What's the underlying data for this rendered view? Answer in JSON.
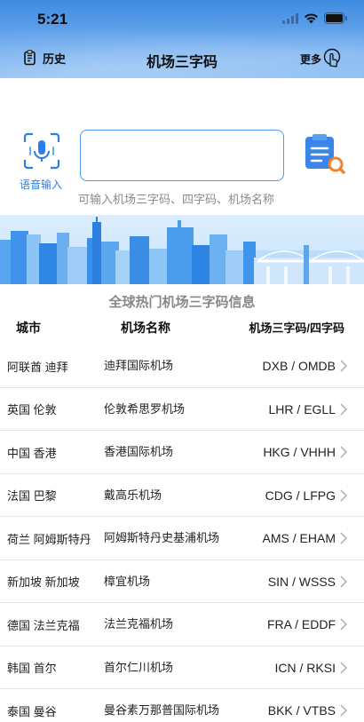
{
  "status": {
    "time": "5:21"
  },
  "nav": {
    "history_label": "历史",
    "title": "机场三字码",
    "more_label": "更多"
  },
  "search": {
    "voice_label": "语音输入",
    "input_value": "",
    "hint": "可输入机场三字码、四字码、机场名称"
  },
  "table": {
    "section_title": "全球热门机场三字码信息",
    "headers": {
      "city": "城市",
      "name": "机场名称",
      "code": "机场三字码/四字码"
    },
    "rows": [
      {
        "city": "阿联酋 迪拜",
        "name": "迪拜国际机场",
        "code": "DXB / OMDB"
      },
      {
        "city": "英国 伦敦",
        "name": "伦敦希思罗机场",
        "code": "LHR / EGLL"
      },
      {
        "city": "中国 香港",
        "name": "香港国际机场",
        "code": "HKG / VHHH"
      },
      {
        "city": "法国 巴黎",
        "name": "戴高乐机场",
        "code": "CDG / LFPG"
      },
      {
        "city": "荷兰 阿姆斯特丹",
        "name": "阿姆斯特丹史基浦机场",
        "code": "AMS / EHAM"
      },
      {
        "city": "新加坡 新加坡",
        "name": "樟宜机场",
        "code": "SIN / WSSS"
      },
      {
        "city": "德国 法兰克福",
        "name": "法兰克福机场",
        "code": "FRA / EDDF"
      },
      {
        "city": "韩国 首尔",
        "name": "首尔仁川机场",
        "code": "ICN / RKSI"
      },
      {
        "city": "泰国 曼谷",
        "name": "曼谷素万那普国际机场",
        "code": "BKK / VTBS"
      }
    ]
  },
  "colors": {
    "accent": "#2b7de9",
    "header_top": "#3f8be0"
  },
  "icons": {
    "history": "history-icon",
    "more": "hand-tap-icon",
    "voice": "microphone-icon",
    "clipboard": "clipboard-search-icon",
    "chevron": "chevron-right-icon"
  }
}
